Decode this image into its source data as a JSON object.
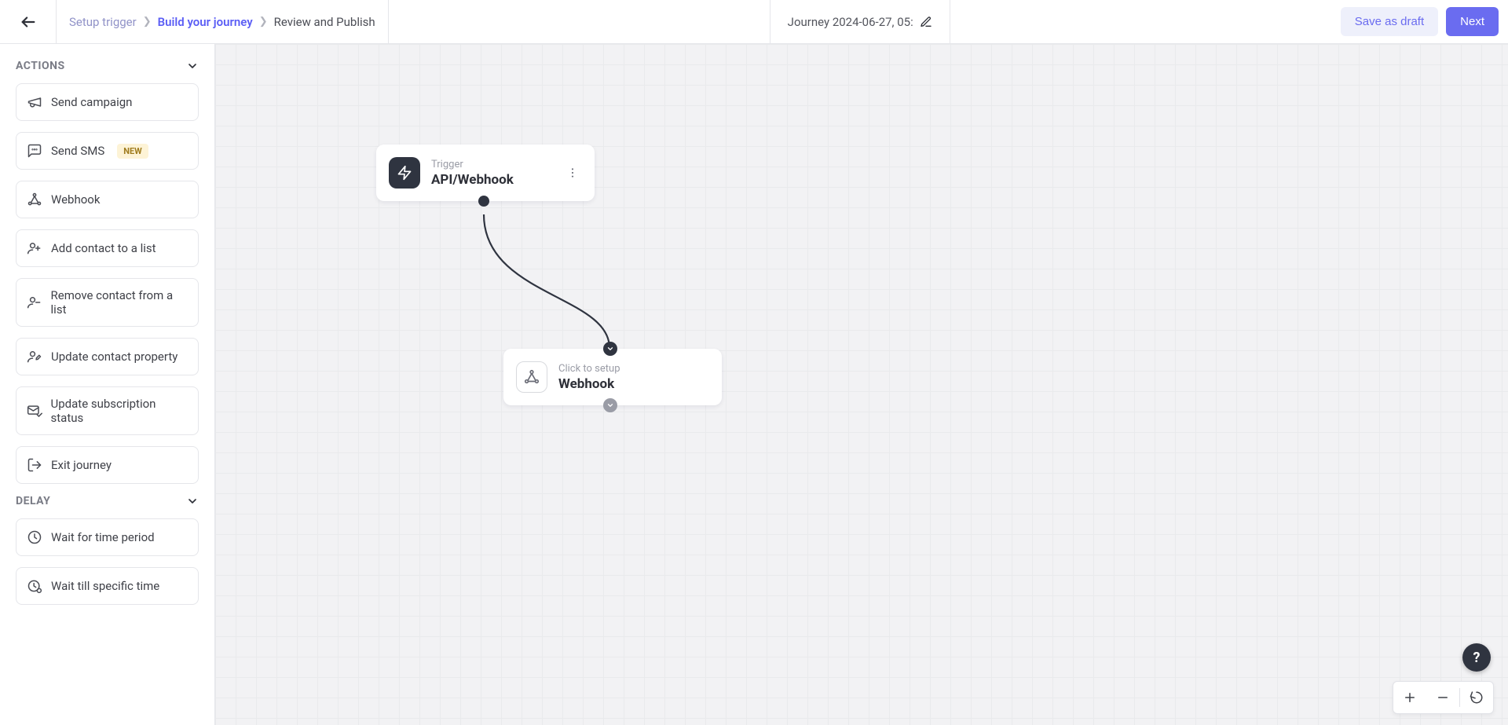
{
  "header": {
    "breadcrumb": [
      {
        "label": "Setup trigger",
        "state": "done"
      },
      {
        "label": "Build your journey",
        "state": "active"
      },
      {
        "label": "Review and Publish",
        "state": "future"
      }
    ],
    "title": "Journey 2024-06-27, 05:",
    "save_draft_label": "Save as draft",
    "next_label": "Next"
  },
  "sidebar": {
    "sections": [
      {
        "title": "ACTIONS",
        "items": [
          {
            "label": "Send campaign",
            "icon": "megaphone-icon",
            "badge": null
          },
          {
            "label": "Send SMS",
            "icon": "chat-icon",
            "badge": "NEW"
          },
          {
            "label": "Webhook",
            "icon": "webhook-icon",
            "badge": null
          },
          {
            "label": "Add contact to a list",
            "icon": "user-plus-icon",
            "badge": null
          },
          {
            "label": "Remove contact from a list",
            "icon": "user-minus-icon",
            "badge": null
          },
          {
            "label": "Update contact property",
            "icon": "user-edit-icon",
            "badge": null
          },
          {
            "label": "Update subscription status",
            "icon": "mail-check-icon",
            "badge": null
          },
          {
            "label": "Exit journey",
            "icon": "exit-icon",
            "badge": null
          }
        ]
      },
      {
        "title": "DELAY",
        "items": [
          {
            "label": "Wait for time period",
            "icon": "clock-icon",
            "badge": null
          },
          {
            "label": "Wait till specific time",
            "icon": "clock-target-icon",
            "badge": null
          }
        ]
      }
    ]
  },
  "canvas": {
    "nodes": {
      "trigger": {
        "overline": "Trigger",
        "title": "API/Webhook"
      },
      "webhook": {
        "overline": "Click to setup",
        "title": "Webhook"
      }
    }
  },
  "help_label": "?"
}
